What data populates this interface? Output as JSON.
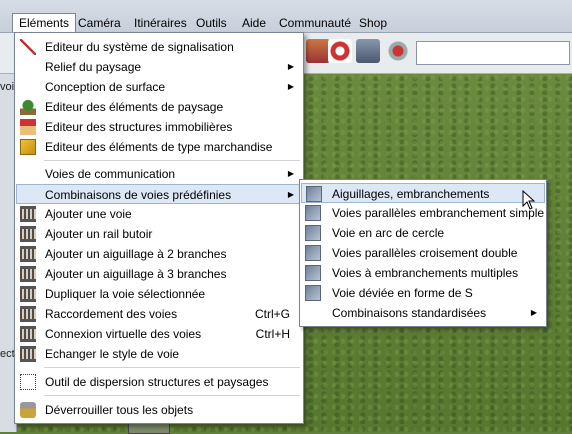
{
  "menubar": {
    "items": [
      "Eléments",
      "Caméra",
      "Itinéraires",
      "Outils",
      "Aide",
      "Communauté",
      "Shop"
    ],
    "active_index": 0
  },
  "left_panel": {
    "fragment_1": "voi",
    "fragment_2": "ect"
  },
  "elements_menu": {
    "items": [
      {
        "label": "Editeur du système de signalisation",
        "icon": "signal-icon",
        "submenu": false
      },
      {
        "label": "Relief du paysage",
        "icon": "",
        "submenu": true
      },
      {
        "label": "Conception de surface",
        "icon": "",
        "submenu": true
      },
      {
        "label": "Editeur des éléments de paysage",
        "icon": "tree-icon",
        "submenu": false
      },
      {
        "label": "Editeur des structures immobilières",
        "icon": "house-icon",
        "submenu": false
      },
      {
        "label": "Editeur des éléments de type marchandise",
        "icon": "crate-icon",
        "submenu": false
      },
      {
        "label": "Voies de communication",
        "icon": "",
        "submenu": true
      },
      {
        "label": "Combinaisons de voies prédéfinies",
        "icon": "",
        "submenu": true,
        "highlighted": true
      },
      {
        "label": "Ajouter une voie",
        "icon": "track-add-icon",
        "submenu": false
      },
      {
        "label": "Ajouter un rail butoir",
        "icon": "buffer-stop-icon",
        "submenu": false
      },
      {
        "label": "Ajouter un aiguillage à 2 branches",
        "icon": "switch-2-icon",
        "submenu": false
      },
      {
        "label": "Ajouter un aiguillage à 3 branches",
        "icon": "switch-3-icon",
        "submenu": false
      },
      {
        "label": "Dupliquer la voie sélectionnée",
        "icon": "duplicate-track-icon",
        "submenu": false
      },
      {
        "label": "Raccordement des voies",
        "icon": "connect-track-icon",
        "shortcut": "Ctrl+G"
      },
      {
        "label": "Connexion virtuelle des voies",
        "icon": "virtual-connect-icon",
        "shortcut": "Ctrl+H"
      },
      {
        "label": "Echanger le style de voie",
        "icon": "swap-style-icon",
        "submenu": false
      },
      {
        "label": "Outil de dispersion structures et paysages",
        "icon": "scatter-icon",
        "submenu": false
      },
      {
        "label": "Déverrouiller tous les objets",
        "icon": "lock-icon",
        "submenu": false
      }
    ]
  },
  "submenu": {
    "items": [
      {
        "label": "Aiguillages, embranchements",
        "highlighted": true
      },
      {
        "label": "Voies parallèles embranchement simple"
      },
      {
        "label": "Voie en arc de cercle"
      },
      {
        "label": "Voies parallèles croisement double"
      },
      {
        "label": "Voies à embranchements multiples"
      },
      {
        "label": "Voie déviée en forme de S"
      },
      {
        "label": "Combinaisons standardisées",
        "submenu": true
      }
    ]
  }
}
